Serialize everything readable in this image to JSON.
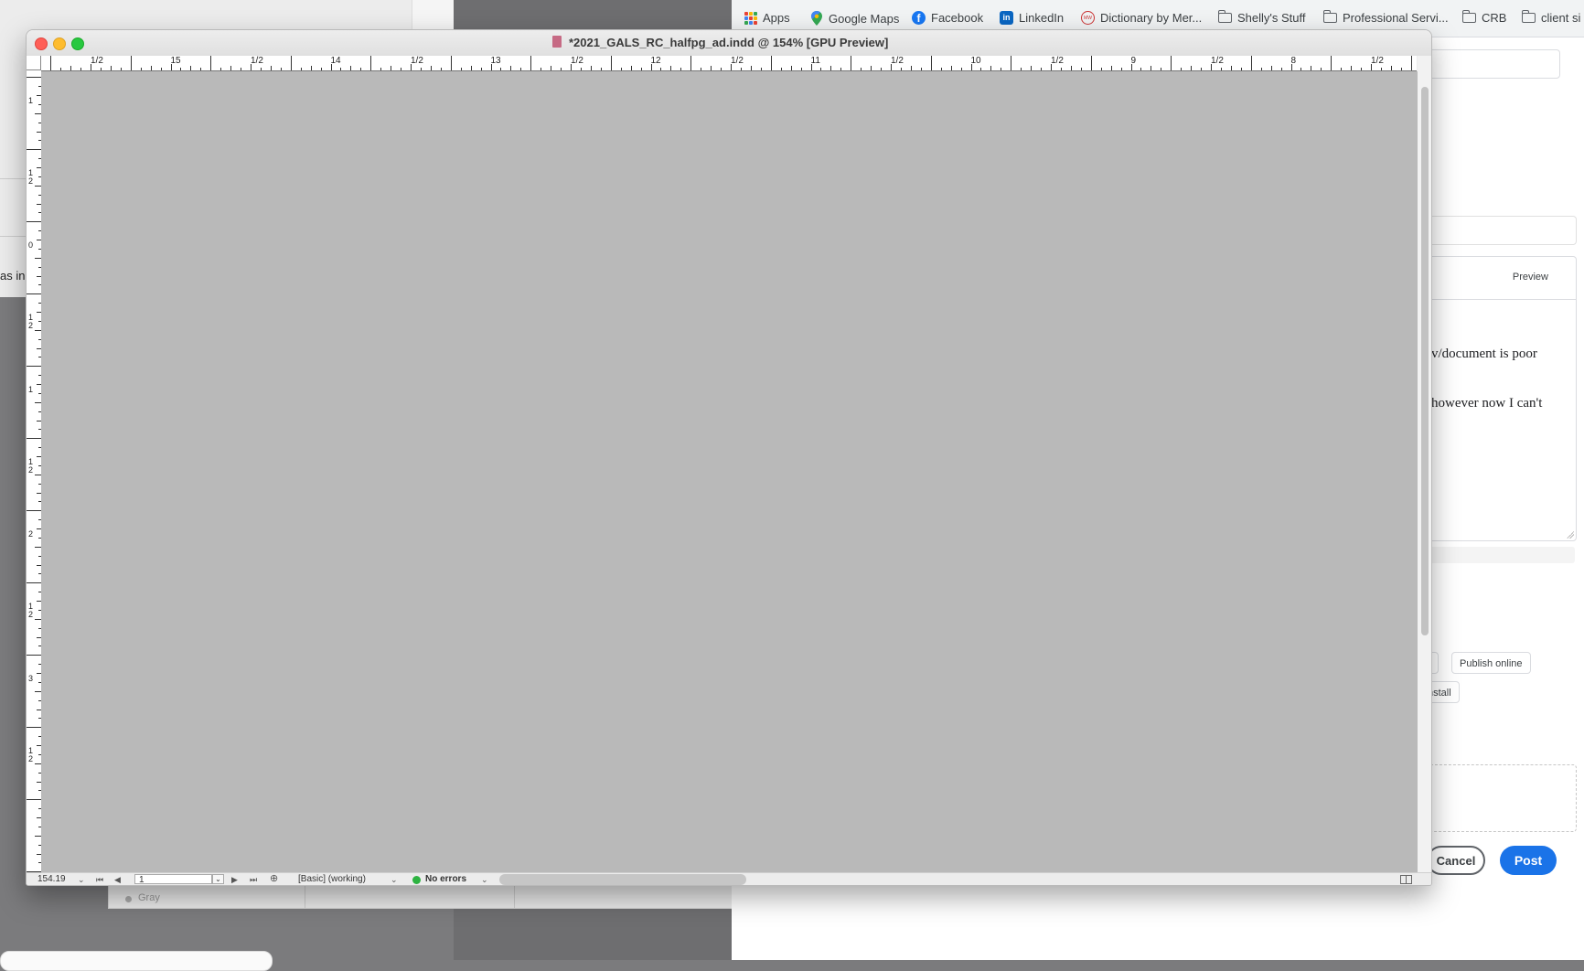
{
  "background": {
    "left_window_text": "as in t",
    "lower_panel_label": "Gray"
  },
  "browser": {
    "bookmarks": [
      {
        "label": "Apps",
        "icon": "apps-grid-icon"
      },
      {
        "label": "Google Maps",
        "icon": "google-maps-icon"
      },
      {
        "label": "Facebook",
        "icon": "facebook-icon"
      },
      {
        "label": "LinkedIn",
        "icon": "linkedin-icon"
      },
      {
        "label": "Dictionary by Mer...",
        "icon": "merriam-webster-icon"
      },
      {
        "label": "Shelly's Stuff",
        "icon": "folder-icon"
      },
      {
        "label": "Professional Servi...",
        "icon": "folder-icon"
      },
      {
        "label": "CRB",
        "icon": "folder-icon"
      },
      {
        "label": "client si",
        "icon": "folder-icon"
      }
    ],
    "editor": {
      "preview_tab": "Preview",
      "body_lines": [
        "v/document is poor",
        "however now I can't"
      ]
    },
    "chips": [
      "t",
      "Publish online",
      "nstall"
    ],
    "cancel_label": "Cancel",
    "post_label": "Post",
    "accent_color": "#1a73e8"
  },
  "indesign": {
    "title": "*2021_GALS_RC_halfpg_ad.indd @ 154% [GPU Preview]",
    "ruler_h_labels": [
      "1/2",
      "15",
      "1/2",
      "14",
      "1/2",
      "13",
      "1/2",
      "12",
      "1/2",
      "11",
      "1/2",
      "10",
      "1/2",
      "9",
      "1/2",
      "8",
      "1/2"
    ],
    "ruler_v_labels": [
      "1",
      "1\n2",
      "0",
      "1\n2",
      "1",
      "1\n2",
      "2",
      "1\n2",
      "3",
      "1\n2"
    ],
    "status": {
      "zoom": "154.19",
      "page": "1",
      "profile": "[Basic] (working)",
      "preflight": "No errors",
      "preflight_color": "#2db341"
    }
  }
}
